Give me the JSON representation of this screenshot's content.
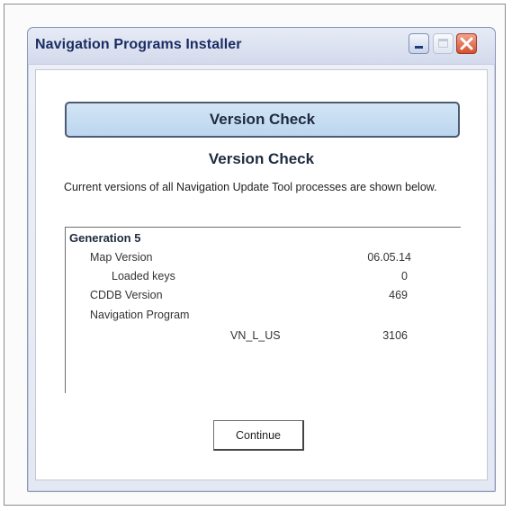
{
  "window": {
    "title": "Navigation Programs Installer"
  },
  "banner": {
    "label": "Version Check"
  },
  "heading": "Version Check",
  "description": "Current versions of all Navigation Update Tool processes are shown below.",
  "versions": {
    "group": "Generation 5",
    "map_version_label": "Map Version",
    "map_version_value": "06.05.14",
    "loaded_keys_label": "Loaded keys",
    "loaded_keys_value": "0",
    "cddb_label": "CDDB Version",
    "cddb_value": "469",
    "nav_program_label": "Navigation Program",
    "nav_program_name": "VN_L_US",
    "nav_program_value": "3106"
  },
  "buttons": {
    "continue": "Continue"
  },
  "icons": {
    "minimize": "minimize-icon",
    "maximize": "maximize-icon",
    "close": "close-x-icon"
  },
  "colors": {
    "title_text": "#1b2d63",
    "banner_fill": "#c8def2",
    "close_button": "#d4512e"
  }
}
